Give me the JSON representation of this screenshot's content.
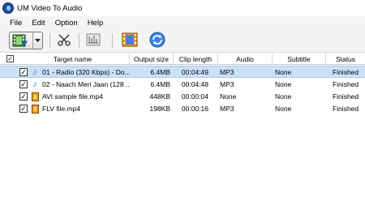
{
  "window": {
    "title": "UM Video To Audio"
  },
  "menu": {
    "items": [
      "File",
      "Edit",
      "Option",
      "Help"
    ]
  },
  "toolbar": {
    "buttons": [
      {
        "name": "add-files",
        "icon": "film-add-icon"
      },
      {
        "name": "cut",
        "icon": "scissors-icon"
      },
      {
        "name": "trim",
        "icon": "trim-icon"
      },
      {
        "name": "convert",
        "icon": "convert-film-icon"
      },
      {
        "name": "refresh",
        "icon": "refresh-icon"
      }
    ]
  },
  "table": {
    "columns": [
      "Target name",
      "Output size",
      "Clip length",
      "Audio",
      "Subtitle",
      "Status"
    ],
    "rows": [
      {
        "checked": true,
        "icon": "music-note-icon",
        "name": "01 - Radio (320 Kbps) - Do...",
        "size": "6.4MB",
        "length": "00:04:49",
        "audio": "MP3",
        "subtitle": "None",
        "status": "Finished",
        "selected": true
      },
      {
        "checked": true,
        "icon": "music-note-icon",
        "name": "02 - Naach Meri Jaan (128 ...",
        "size": "6.4MB",
        "length": "00:04:48",
        "audio": "MP3",
        "subtitle": "None",
        "status": "Finished",
        "selected": false
      },
      {
        "checked": true,
        "icon": "film-icon",
        "name": "AVI sample file.mp4",
        "size": "448KB",
        "length": "00:00:04",
        "audio": "None",
        "subtitle": "None",
        "status": "Finished",
        "selected": false
      },
      {
        "checked": true,
        "icon": "film-icon",
        "name": "FLV file.mp4",
        "size": "198KB",
        "length": "00:00:16",
        "audio": "MP3",
        "subtitle": "None",
        "status": "Finished",
        "selected": false
      }
    ]
  },
  "colors": {
    "selection": "#cce0f8",
    "header_border": "#c9c9c9"
  }
}
